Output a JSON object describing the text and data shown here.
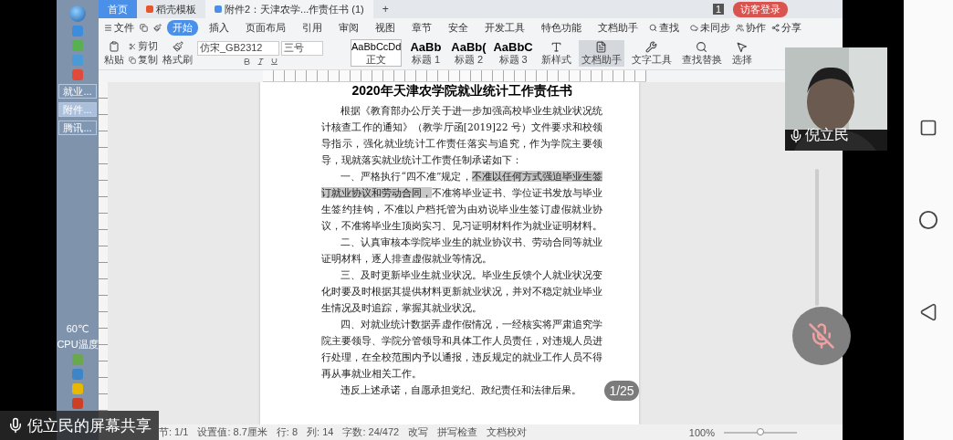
{
  "taskbar": {
    "tasks": [
      {
        "label": "就业...",
        "selected": false
      },
      {
        "label": "附件...",
        "selected": true
      },
      {
        "label": "腾讯...",
        "selected": false
      }
    ],
    "temperature": "60℃",
    "temperature_label": "CPU温度"
  },
  "tabs": [
    {
      "label": "首页",
      "kind": "home",
      "selected": false
    },
    {
      "label": "稻壳模板",
      "kind": "template",
      "selected": false
    },
    {
      "label": "附件2：天津农学...作责任书 (1)",
      "kind": "document",
      "selected": true
    }
  ],
  "new_tab": "+",
  "notice_count": "1",
  "login": "访客登录",
  "menu": {
    "file": "文件",
    "items": [
      {
        "label": "开始",
        "selected": true
      },
      {
        "label": "插入",
        "selected": false
      },
      {
        "label": "页面布局",
        "selected": false
      },
      {
        "label": "引用",
        "selected": false
      },
      {
        "label": "审阅",
        "selected": false
      },
      {
        "label": "视图",
        "selected": false
      },
      {
        "label": "章节",
        "selected": false
      },
      {
        "label": "安全",
        "selected": false
      },
      {
        "label": "开发工具",
        "selected": false
      },
      {
        "label": "特色功能",
        "selected": false
      },
      {
        "label": "文档助手",
        "selected": false
      }
    ],
    "search": "查找",
    "sync": "未同步",
    "collab": "协作",
    "share": "分享"
  },
  "toolbar": {
    "paste": "粘贴",
    "cut": "剪切",
    "copy": "复制",
    "format_painter": "格式刷",
    "font": "仿宋_GB2312",
    "size": "三号",
    "styles": [
      {
        "sample": "AaBbCcDd",
        "label": "正文",
        "selected": true
      },
      {
        "sample": "AaBb",
        "label": "标题 1",
        "selected": false
      },
      {
        "sample": "AaBb(",
        "label": "标题 2",
        "selected": false
      },
      {
        "sample": "AaBbC",
        "label": "标题 3",
        "selected": false
      }
    ],
    "tools": [
      {
        "label": "新样式",
        "kind": "styles",
        "selected": false
      },
      {
        "label": "文档助手",
        "kind": "assistant",
        "selected": true
      },
      {
        "label": "文字工具",
        "kind": "wrench",
        "selected": false
      },
      {
        "label": "查找替换",
        "kind": "search",
        "selected": false
      },
      {
        "label": "选择",
        "kind": "pointer",
        "selected": false
      }
    ]
  },
  "document": {
    "title": "2020年天津农学院就业统计工作责任书",
    "paragraphs": [
      [
        {
          "text": "根据《教育部办公厅关于进一步加强高校毕业生就业状况统计核查工作的通知》（教学厅函[2019]22 号）文件要求和校领导指示，强化就业统计工作责任落实与追究，作为学院主要领导，现就落实就业统计工作责任制承诺如下：",
          "selected": false
        }
      ],
      [
        {
          "text": "一、严格执行“四不准”规定，",
          "selected": false
        },
        {
          "text": "不准以任何方式强迫毕业生签订就业协议和劳动合同，",
          "selected": true
        },
        {
          "text": "不准将毕业证书、学位证书发放与毕业生签约挂钩，不准以户档托管为由劝说毕业生签订虚假就业协议，不准将毕业生顶岗实习、见习证明材料作为就业证明材料。",
          "selected": false
        }
      ],
      [
        {
          "text": "二、认真审核本学院毕业生的就业协议书、劳动合同等就业证明材料，逐人排查虚假就业等情况。",
          "selected": false
        }
      ],
      [
        {
          "text": "三、及时更新毕业生就业状况。毕业生反馈个人就业状况变化时要及时根据其提供材料更新就业状况，并对不稳定就业毕业生情况及时追踪，掌握其就业状况。",
          "selected": false
        }
      ],
      [
        {
          "text": "四、对就业统计数据弄虚作假情况，一经核实将严肃追究学院主要领导、学院分管领导和具体工作人员责任，对违规人员进行处理，在全校范围内予以通报，违反规定的就业工作人员不得再从事就业相关工作。",
          "selected": false
        }
      ],
      [
        {
          "text": "违反上述承诺，自愿承担党纪、政纪责任和法律后果。",
          "selected": false
        }
      ]
    ]
  },
  "page_badge": "1/25",
  "status_bar": {
    "items": [
      "节: 1/1",
      "设置值: 8.7厘米",
      "行: 8",
      "列: 14",
      "字数: 24/472"
    ],
    "checks": [
      "改写",
      "拼写检查",
      "文档校对"
    ],
    "zoom": "100%",
    "zoom_slider": {
      "level": 0.5
    }
  },
  "video_tile": {
    "name": "倪立民"
  },
  "mute_button": {
    "muted": true
  },
  "share_label": "倪立民的屏幕共享"
}
